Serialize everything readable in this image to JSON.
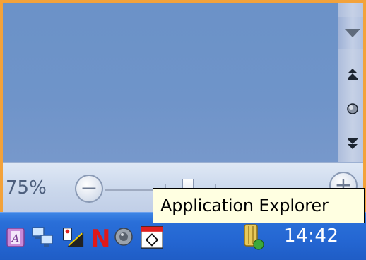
{
  "status_bar": {
    "zoom_level": "75%",
    "zoom_out_symbol": "−",
    "zoom_in_symbol": "+"
  },
  "tooltip": {
    "text": "Application Explorer"
  },
  "scrollbar": {
    "icons": [
      "scroll-up-icon",
      "previous-page-icon",
      "select-browse-object-icon",
      "next-page-icon"
    ]
  },
  "taskbar": {
    "icons": [
      "onenote-icon",
      "network-icon",
      "paint-icon",
      "norton-icon",
      "speaker-icon",
      "calendar-icon",
      "security-shield-icon"
    ],
    "clock": "14:42"
  },
  "colors": {
    "accent_border": "#f3a23a",
    "document_background": "#6f94c9",
    "taskbar": "#2466d2",
    "tooltip_background": "#ffffe1"
  }
}
